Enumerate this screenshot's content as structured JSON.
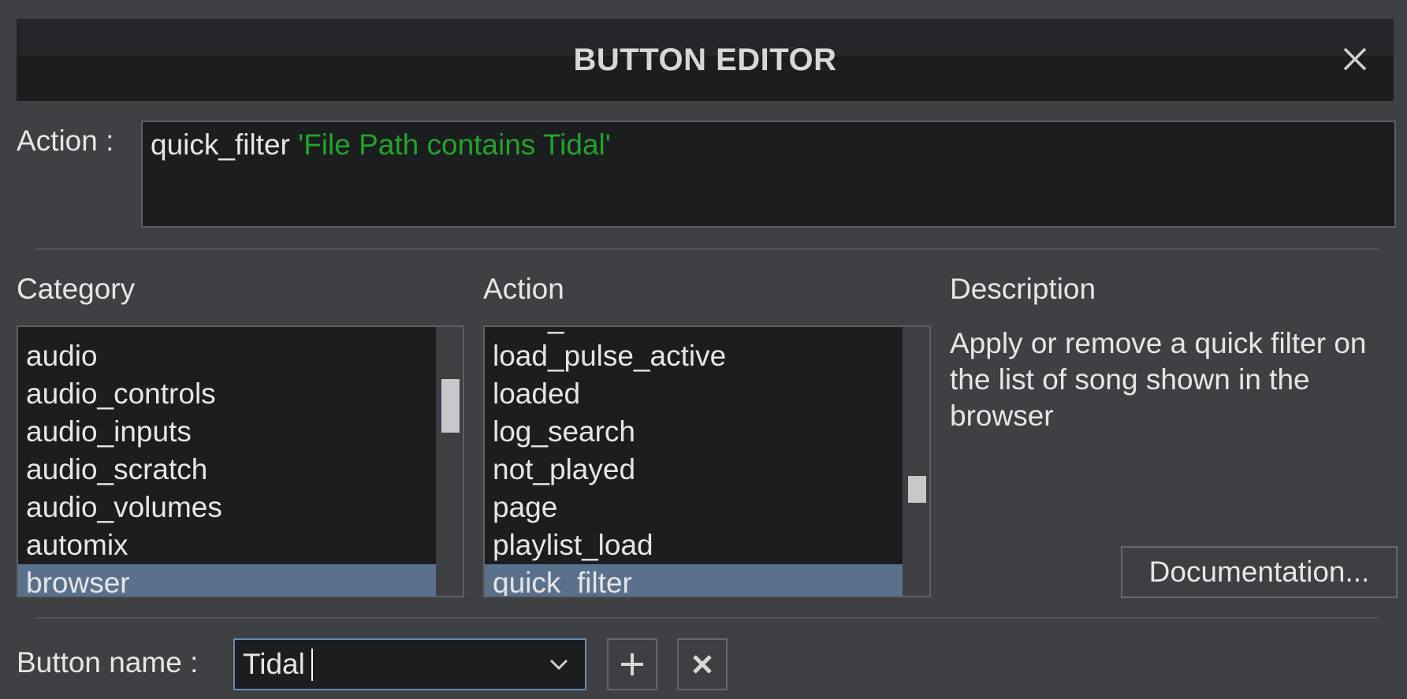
{
  "dialog": {
    "title": "BUTTON EDITOR",
    "close_icon": "close-icon"
  },
  "action_field": {
    "label": "Action :",
    "command": "quick_filter",
    "argument": "'File Path contains Tidal'",
    "colors": {
      "command": "#e6e6e6",
      "argument": "#22a32b"
    }
  },
  "columns": {
    "category_title": "Category",
    "action_title": "Action",
    "description_title": "Description"
  },
  "category_list": {
    "items": [
      "audio",
      "audio_controls",
      "audio_inputs",
      "audio_scratch",
      "audio_volumes",
      "automix",
      "browser"
    ],
    "selected": "browser"
  },
  "action_list": {
    "partial_top_item": "_",
    "items": [
      "load_pulse_active",
      "loaded",
      "log_search",
      "not_played",
      "page",
      "playlist_load",
      "quick_filter"
    ],
    "selected": "quick_filter"
  },
  "description": {
    "text": "Apply or remove a quick filter on the list of song shown in the browser",
    "documentation_button": "Documentation..."
  },
  "button_name": {
    "label": "Button name :",
    "value": "Tidal",
    "add_icon": "plus-icon",
    "delete_icon": "delete-icon"
  },
  "colors": {
    "background": "#3f4043",
    "panel": "#1c1d1f",
    "selection": "#5a718e",
    "border": "#5f6064"
  }
}
